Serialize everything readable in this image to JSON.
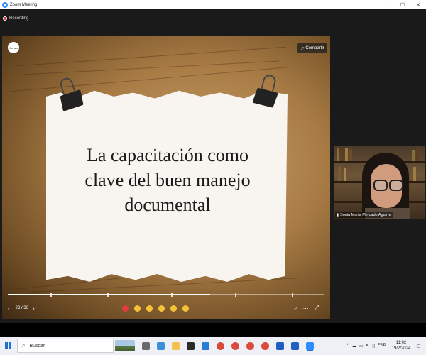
{
  "window": {
    "title": "Zoom Meeting",
    "minimize": "─",
    "maximize": "☐",
    "close": "✕"
  },
  "meeting": {
    "recording_label": "Recording"
  },
  "slide": {
    "title_line1": "La capacitación como",
    "title_line2": "clave del buen manejo",
    "title_line3": "documental",
    "logo_text": "Canva",
    "share_label": "Compartir",
    "page_indicator": "23 / 36",
    "progress_fraction": 0.64
  },
  "participant": {
    "name": "Sonia María Mercado Aguirre"
  },
  "taskbar": {
    "search_placeholder": "Buscar",
    "language": "ESP",
    "time": "11:02",
    "date": "19/2/2024"
  },
  "colors": {
    "zoom_blue": "#2d8cff",
    "recording_red": "#e3383a",
    "windows_blue": "#1f6fd1"
  }
}
